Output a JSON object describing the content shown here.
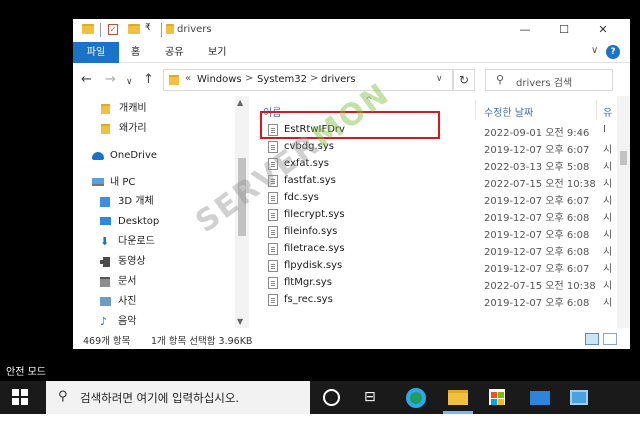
{
  "window": {
    "title": "drivers",
    "controls": {
      "minimize": "—",
      "maximize": "☐",
      "close": "✕"
    }
  },
  "ribbon": {
    "tabs": [
      "파일",
      "홈",
      "공유",
      "보기"
    ],
    "expand": "∨",
    "help": "?"
  },
  "address": {
    "back": "←",
    "forward": "→",
    "recent": "∨",
    "up": "↑",
    "overflow": "«",
    "crumbs": [
      "Windows",
      "System32",
      "drivers"
    ],
    "separator": ">",
    "dropdown": "∨",
    "refresh": "↻",
    "search_placeholder": "drivers 검색",
    "search_icon": "search-icon"
  },
  "nav": {
    "items": [
      {
        "label": "개캐비",
        "icon": "folder-icon"
      },
      {
        "label": "왜가리",
        "icon": "folder-icon"
      },
      {
        "label": "OneDrive",
        "icon": "onedrive-icon"
      },
      {
        "label": "내 PC",
        "icon": "pc-icon"
      },
      {
        "label": "3D 개체",
        "icon": "3d-objects-icon"
      },
      {
        "label": "Desktop",
        "icon": "desktop-icon"
      },
      {
        "label": "다운로드",
        "icon": "download-icon"
      },
      {
        "label": "동영상",
        "icon": "video-icon"
      },
      {
        "label": "문서",
        "icon": "documents-icon"
      },
      {
        "label": "사진",
        "icon": "pictures-icon"
      },
      {
        "label": "음악",
        "icon": "music-icon"
      }
    ]
  },
  "list": {
    "sort_indicator": "^",
    "columns": {
      "name": "이름",
      "date": "수정한 날짜",
      "type": "유"
    },
    "files": [
      {
        "name": "EstRtwIFDrv",
        "date": "2022-09-01 오전 9:46",
        "type": "I"
      },
      {
        "name": "cvbdg.sys",
        "date": "2019-12-07 오후 6:07",
        "type": "시"
      },
      {
        "name": "exfat.sys",
        "date": "2022-03-13 오후 5:08",
        "type": "시"
      },
      {
        "name": "fastfat.sys",
        "date": "2022-07-15 오전 10:38",
        "type": "시"
      },
      {
        "name": "fdc.sys",
        "date": "2019-12-07 오후 6:07",
        "type": "시"
      },
      {
        "name": "filecrypt.sys",
        "date": "2019-12-07 오후 6:08",
        "type": "시"
      },
      {
        "name": "fileinfo.sys",
        "date": "2019-12-07 오후 6:08",
        "type": "시"
      },
      {
        "name": "filetrace.sys",
        "date": "2019-12-07 오후 6:08",
        "type": "시"
      },
      {
        "name": "flpydisk.sys",
        "date": "2019-12-07 오후 6:07",
        "type": "시"
      },
      {
        "name": "fltMgr.sys",
        "date": "2022-07-15 오전 10:38",
        "type": "시"
      },
      {
        "name": "fs_rec.sys",
        "date": "2019-12-07 오후 6:08",
        "type": "시"
      }
    ]
  },
  "status": {
    "count": "469개 항목",
    "selection": "1개 항목 선택함 3.96KB"
  },
  "watermark": {
    "prefix": "SERVER",
    "suffix": "MON"
  },
  "desktop": {
    "safe_mode_label": "안전 모드"
  },
  "taskbar": {
    "search_text": "검색하려면 여기에 입력하십시오.",
    "search_icon": "search-icon",
    "taskview_glyph": "⊟"
  },
  "colors": {
    "accent": "#1a73c9",
    "highlight_box": "#e0141e",
    "taskbar": "#1a1a1a"
  }
}
